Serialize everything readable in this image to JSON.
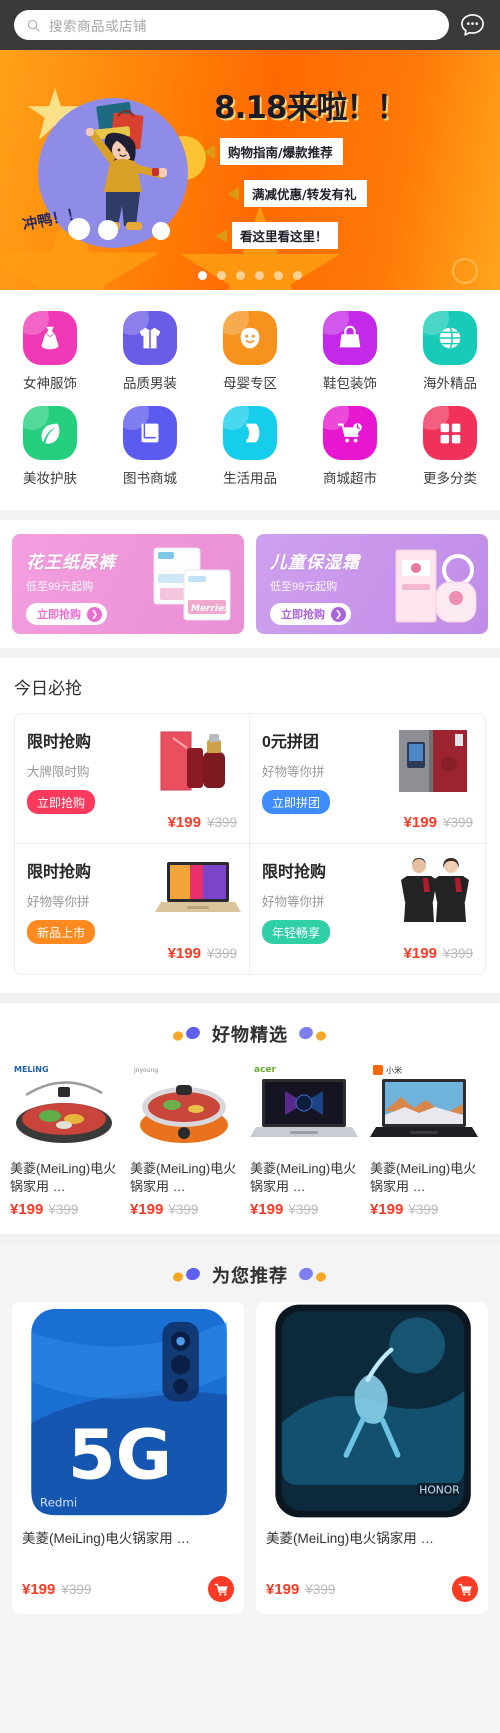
{
  "search": {
    "placeholder": "搜索商品或店铺",
    "search_icon": "search-icon",
    "chat_icon": "chat-bubble-icon"
  },
  "banner": {
    "title": "8.18来啦！！",
    "sticker": "冲鸭！！",
    "callouts": [
      "购物指南/爆款推荐",
      "满减优惠/转发有礼",
      "看这里看这里！"
    ],
    "dots_total": 6,
    "dots_active": 1,
    "bg_from": "#ffa217",
    "bg_to": "#ff6a00"
  },
  "categories": [
    {
      "label": "女神服饰",
      "icon": "dress-icon",
      "color": "#ef39b7"
    },
    {
      "label": "品质男装",
      "icon": "shirt-icon",
      "color": "#6b5ce7"
    },
    {
      "label": "母婴专区",
      "icon": "baby-icon",
      "color": "#f7921e"
    },
    {
      "label": "鞋包装饰",
      "icon": "handbag-icon",
      "color": "#c428e8"
    },
    {
      "label": "海外精品",
      "icon": "globe-icon",
      "color": "#17cbb8"
    },
    {
      "label": "美妆护肤",
      "icon": "leaf-icon",
      "color": "#26cf7e"
    },
    {
      "label": "图书商城",
      "icon": "book-icon",
      "color": "#5b5bf0"
    },
    {
      "label": "生活用品",
      "icon": "paper-roll-icon",
      "color": "#17cdec"
    },
    {
      "label": "商城超市",
      "icon": "shopping-cart-icon",
      "color": "#e716d1"
    },
    {
      "label": "更多分类",
      "icon": "grid-more-icon",
      "color": "#f0325b"
    }
  ],
  "promos": [
    {
      "title": "花王纸尿裤",
      "subtitle": "低至99元起购",
      "button": "立即抢购",
      "arrow_icon": "chevron-right-icon",
      "accent": "#e96fce"
    },
    {
      "title": "儿童保湿霜",
      "subtitle": "低至99元起购",
      "button": "立即抢购",
      "arrow_icon": "chevron-right-icon",
      "accent": "#ab63dd"
    }
  ],
  "today": {
    "heading": "今日必抢",
    "cards": [
      {
        "title": "限时抢购",
        "subtitle": "大牌限时购",
        "tag": "立即抢购",
        "tag_color": "red",
        "price": "¥199",
        "old_price": "¥399",
        "image": "cosmetic-serum-photo"
      },
      {
        "title": "0元拼团",
        "subtitle": "好物等你拼",
        "tag": "立即拼团",
        "tag_color": "blue",
        "price": "¥199",
        "old_price": "¥399",
        "image": "refrigerator-photo"
      },
      {
        "title": "限时抢购",
        "subtitle": "好物等你拼",
        "tag": "新品上市",
        "tag_color": "org",
        "price": "¥199",
        "old_price": "¥399",
        "image": "laptop-photo"
      },
      {
        "title": "限时抢购",
        "subtitle": "好物等你拼",
        "tag": "年轻畅享",
        "tag_color": "grn",
        "price": "¥199",
        "old_price": "¥399",
        "image": "sportswear-couple-photo"
      }
    ]
  },
  "picks": {
    "heading": "好物精选",
    "items": [
      {
        "name": "美菱(MeiLing)电火锅家用 …",
        "price": "¥199",
        "old_price": "¥399",
        "brand": "MELiNG美菱",
        "image": "electric-hotpot-photo"
      },
      {
        "name": "美菱(MeiLing)电火锅家用 …",
        "price": "¥199",
        "old_price": "¥399",
        "brand": "九阳Joyoung",
        "image": "orange-hotpot-photo"
      },
      {
        "name": "美菱(MeiLing)电火锅家用 …",
        "price": "¥199",
        "old_price": "¥399",
        "brand": "acer宏碁",
        "image": "acer-laptop-photo"
      },
      {
        "name": "美菱(MeiLing)电火锅家用 …",
        "price": "¥199",
        "old_price": "¥399",
        "brand": "小米",
        "image": "xiaomi-laptop-photo"
      }
    ]
  },
  "recommend": {
    "heading": "为您推荐",
    "items": [
      {
        "name": "美菱(MeiLing)电火锅家用 …",
        "price": "¥199",
        "old_price": "¥399",
        "cart_icon": "cart-icon",
        "image": "blue-5g-phone-photo"
      },
      {
        "name": "美菱(MeiLing)电火锅家用 …",
        "price": "¥199",
        "old_price": "¥399",
        "cart_icon": "cart-icon",
        "image": "honor-phone-photo"
      }
    ]
  }
}
